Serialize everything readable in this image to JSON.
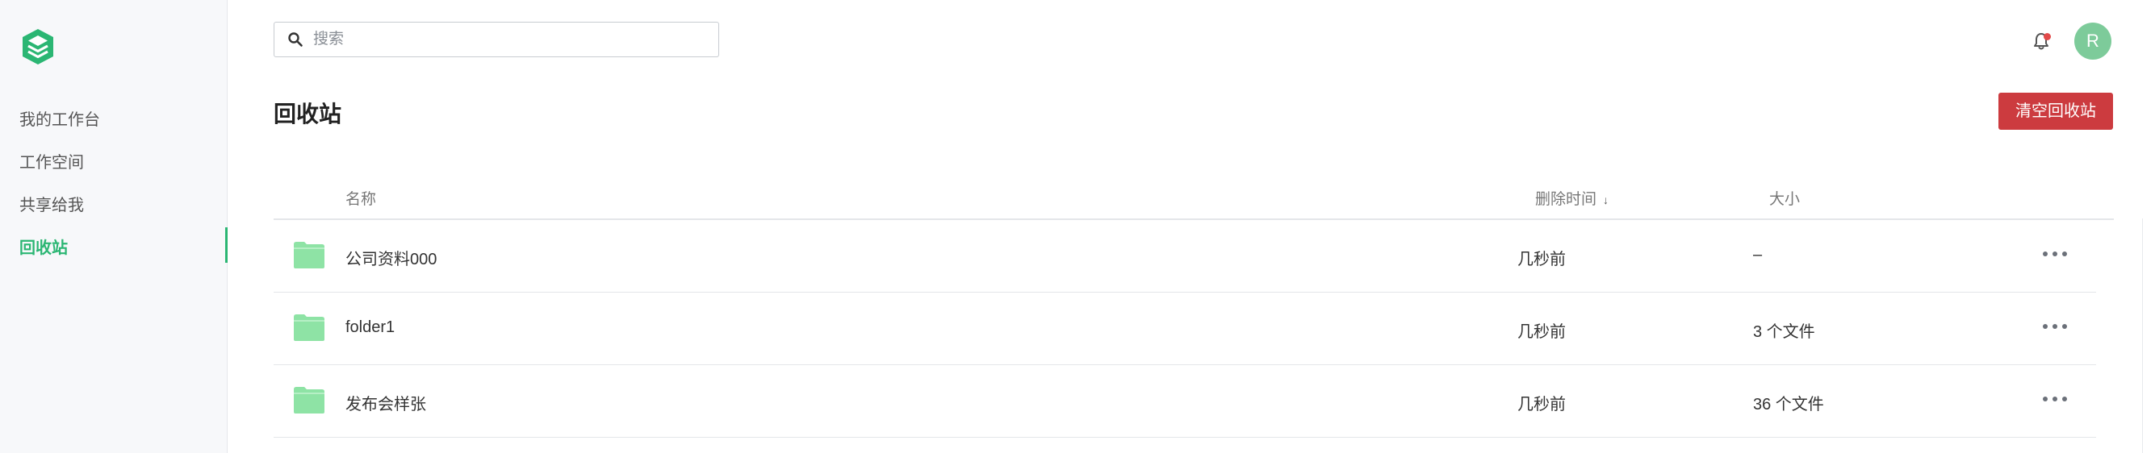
{
  "search": {
    "placeholder": "搜索",
    "value": ""
  },
  "sidebar": {
    "items": [
      {
        "label": "我的工作台"
      },
      {
        "label": "工作空间"
      },
      {
        "label": "共享给我"
      },
      {
        "label": "回收站"
      }
    ],
    "active_index": 3
  },
  "header": {
    "avatar_initial": "R"
  },
  "page": {
    "title": "回收站",
    "clear_button_label": "清空回收站"
  },
  "table": {
    "columns": {
      "name": "名称",
      "deleted_time": "删除时间",
      "size": "大小"
    },
    "sort_indicator": "↓",
    "rows": [
      {
        "name": "公司资料000",
        "deleted_time": "几秒前",
        "size": "–"
      },
      {
        "name": "folder1",
        "deleted_time": "几秒前",
        "size": "3 个文件"
      },
      {
        "name": "发布会样张",
        "deleted_time": "几秒前",
        "size": "36 个文件"
      }
    ]
  },
  "colors": {
    "accent": "#2bb673",
    "danger": "#cc3b3f",
    "folder": "#8ee3a5",
    "avatar": "#7dcb9a",
    "notification_dot": "#e24a4a"
  },
  "icons": {
    "logo": "cube-logo-icon",
    "search": "search-icon",
    "bell": "bell-icon",
    "folder": "folder-icon",
    "more": "more-horizontal-icon"
  }
}
